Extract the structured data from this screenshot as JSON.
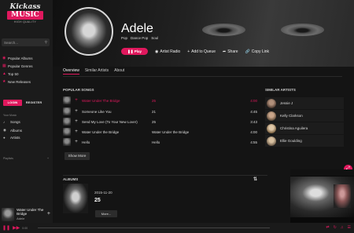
{
  "logo": {
    "line1": "Kickass",
    "line2": "MUSIC",
    "line3": "HIGH QUALITY"
  },
  "search": {
    "placeholder": "Search..."
  },
  "nav": [
    {
      "label": "Popular Albums",
      "icon": "disc-icon"
    },
    {
      "label": "Popular Genres",
      "icon": "grid-icon"
    },
    {
      "label": "Top 50",
      "icon": "chart-icon"
    },
    {
      "label": "New Releases",
      "icon": "star-icon"
    }
  ],
  "auth": {
    "login": "LOGIN",
    "register": "REGISTER"
  },
  "my_music": {
    "heading": "Your Music",
    "items": [
      {
        "label": "Songs",
        "icon": "note-icon"
      },
      {
        "label": "Albums",
        "icon": "disc-icon"
      },
      {
        "label": "Artists",
        "icon": "mic-icon"
      }
    ]
  },
  "playlists": {
    "heading": "Playlists",
    "add": "+"
  },
  "now_playing": {
    "title": "Water Under The Bridge",
    "artist": "Adele"
  },
  "artist": {
    "name": "Adele",
    "genres": [
      "Pop",
      "Dance Pop",
      "Soul"
    ],
    "actions": {
      "play": "Play",
      "radio": "Artist Radio",
      "queue": "Add to Queue",
      "share": "Share",
      "copy": "Copy Link"
    }
  },
  "tabs": [
    "Overview",
    "Similar Artists",
    "About"
  ],
  "popular_songs": {
    "heading": "POPULAR SONGS",
    "rows": [
      {
        "title": "Water Under The Bridge",
        "album": "25",
        "duration": "4:00"
      },
      {
        "title": "Someone Like You",
        "album": "21",
        "duration": "4:45"
      },
      {
        "title": "Send My Love (To Your New Lover)",
        "album": "25",
        "duration": "3:43"
      },
      {
        "title": "Water Under the Bridge",
        "album": "Water Under the Bridge",
        "duration": "4:00"
      },
      {
        "title": "Hello",
        "album": "Hello",
        "duration": "4:55"
      }
    ],
    "show_more": "Show More"
  },
  "similar_artists": {
    "heading": "SIMILAR ARTISTS",
    "items": [
      "Jessie J",
      "Kelly Clarkson",
      "Christina Aguilera",
      "Ellie Goulding"
    ]
  },
  "albums": {
    "heading": "ALBUMS",
    "items": [
      {
        "date": "2015-11-20",
        "title": "25"
      }
    ],
    "more": "More..."
  },
  "player": {
    "time_elapsed": "0:00",
    "progress": 0.0
  },
  "colors": {
    "accent": "#e0185d",
    "background": "#141414",
    "sidebar": "#1b1b1b"
  }
}
